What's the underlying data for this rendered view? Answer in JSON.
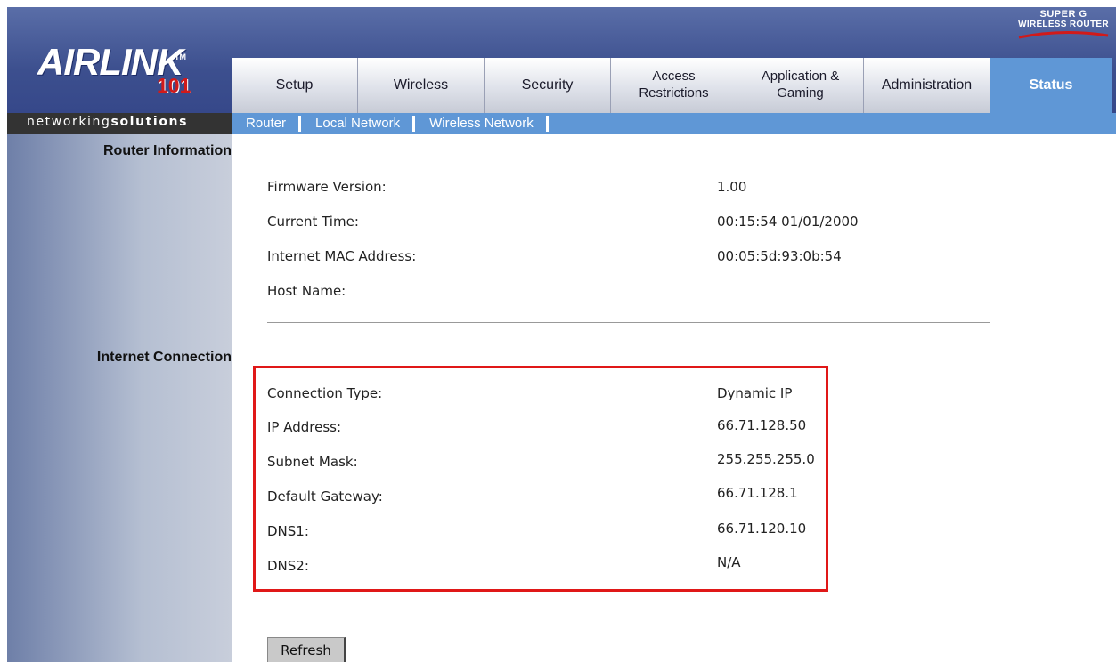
{
  "brand": {
    "logo_text": "AIRLINK",
    "logo_tm": "TM",
    "logo_number": "101",
    "tagline_light": "networking",
    "tagline_bold": "solutions",
    "product_line1": "SUPER G",
    "product_line2": "WIRELESS ROUTER"
  },
  "tabs": [
    {
      "label": "Setup"
    },
    {
      "label": "Wireless"
    },
    {
      "label": "Security"
    },
    {
      "label": "Access Restrictions"
    },
    {
      "label": "Application & Gaming"
    },
    {
      "label": "Administration"
    },
    {
      "label": "Status",
      "active": true
    }
  ],
  "subnav": [
    "Router",
    "Local Network",
    "Wireless Network"
  ],
  "sections": {
    "router_info": "Router Information",
    "internet_connection": "Internet Connection"
  },
  "router_info": [
    {
      "label": "Firmware Version:",
      "value": "1.00"
    },
    {
      "label": "Current Time:",
      "value": "00:15:54 01/01/2000"
    },
    {
      "label": "Internet MAC Address:",
      "value": "00:05:5d:93:0b:54"
    },
    {
      "label": "Host Name:",
      "value": ""
    }
  ],
  "internet": [
    {
      "label": "Connection Type:",
      "value": "Dynamic IP"
    },
    {
      "label": "IP Address:",
      "value": "66.71.128.50"
    },
    {
      "label": "Subnet Mask:",
      "value": "255.255.255.0"
    },
    {
      "label": "Default Gateway:",
      "value": "66.71.128.1"
    },
    {
      "label": "DNS1:",
      "value": "66.71.120.10"
    },
    {
      "label": "DNS2:",
      "value": "N/A"
    }
  ],
  "refresh_label": "Refresh",
  "colors": {
    "header": "#3c4f8e",
    "active_tab": "#5f97d6",
    "highlight": "#e01818"
  }
}
